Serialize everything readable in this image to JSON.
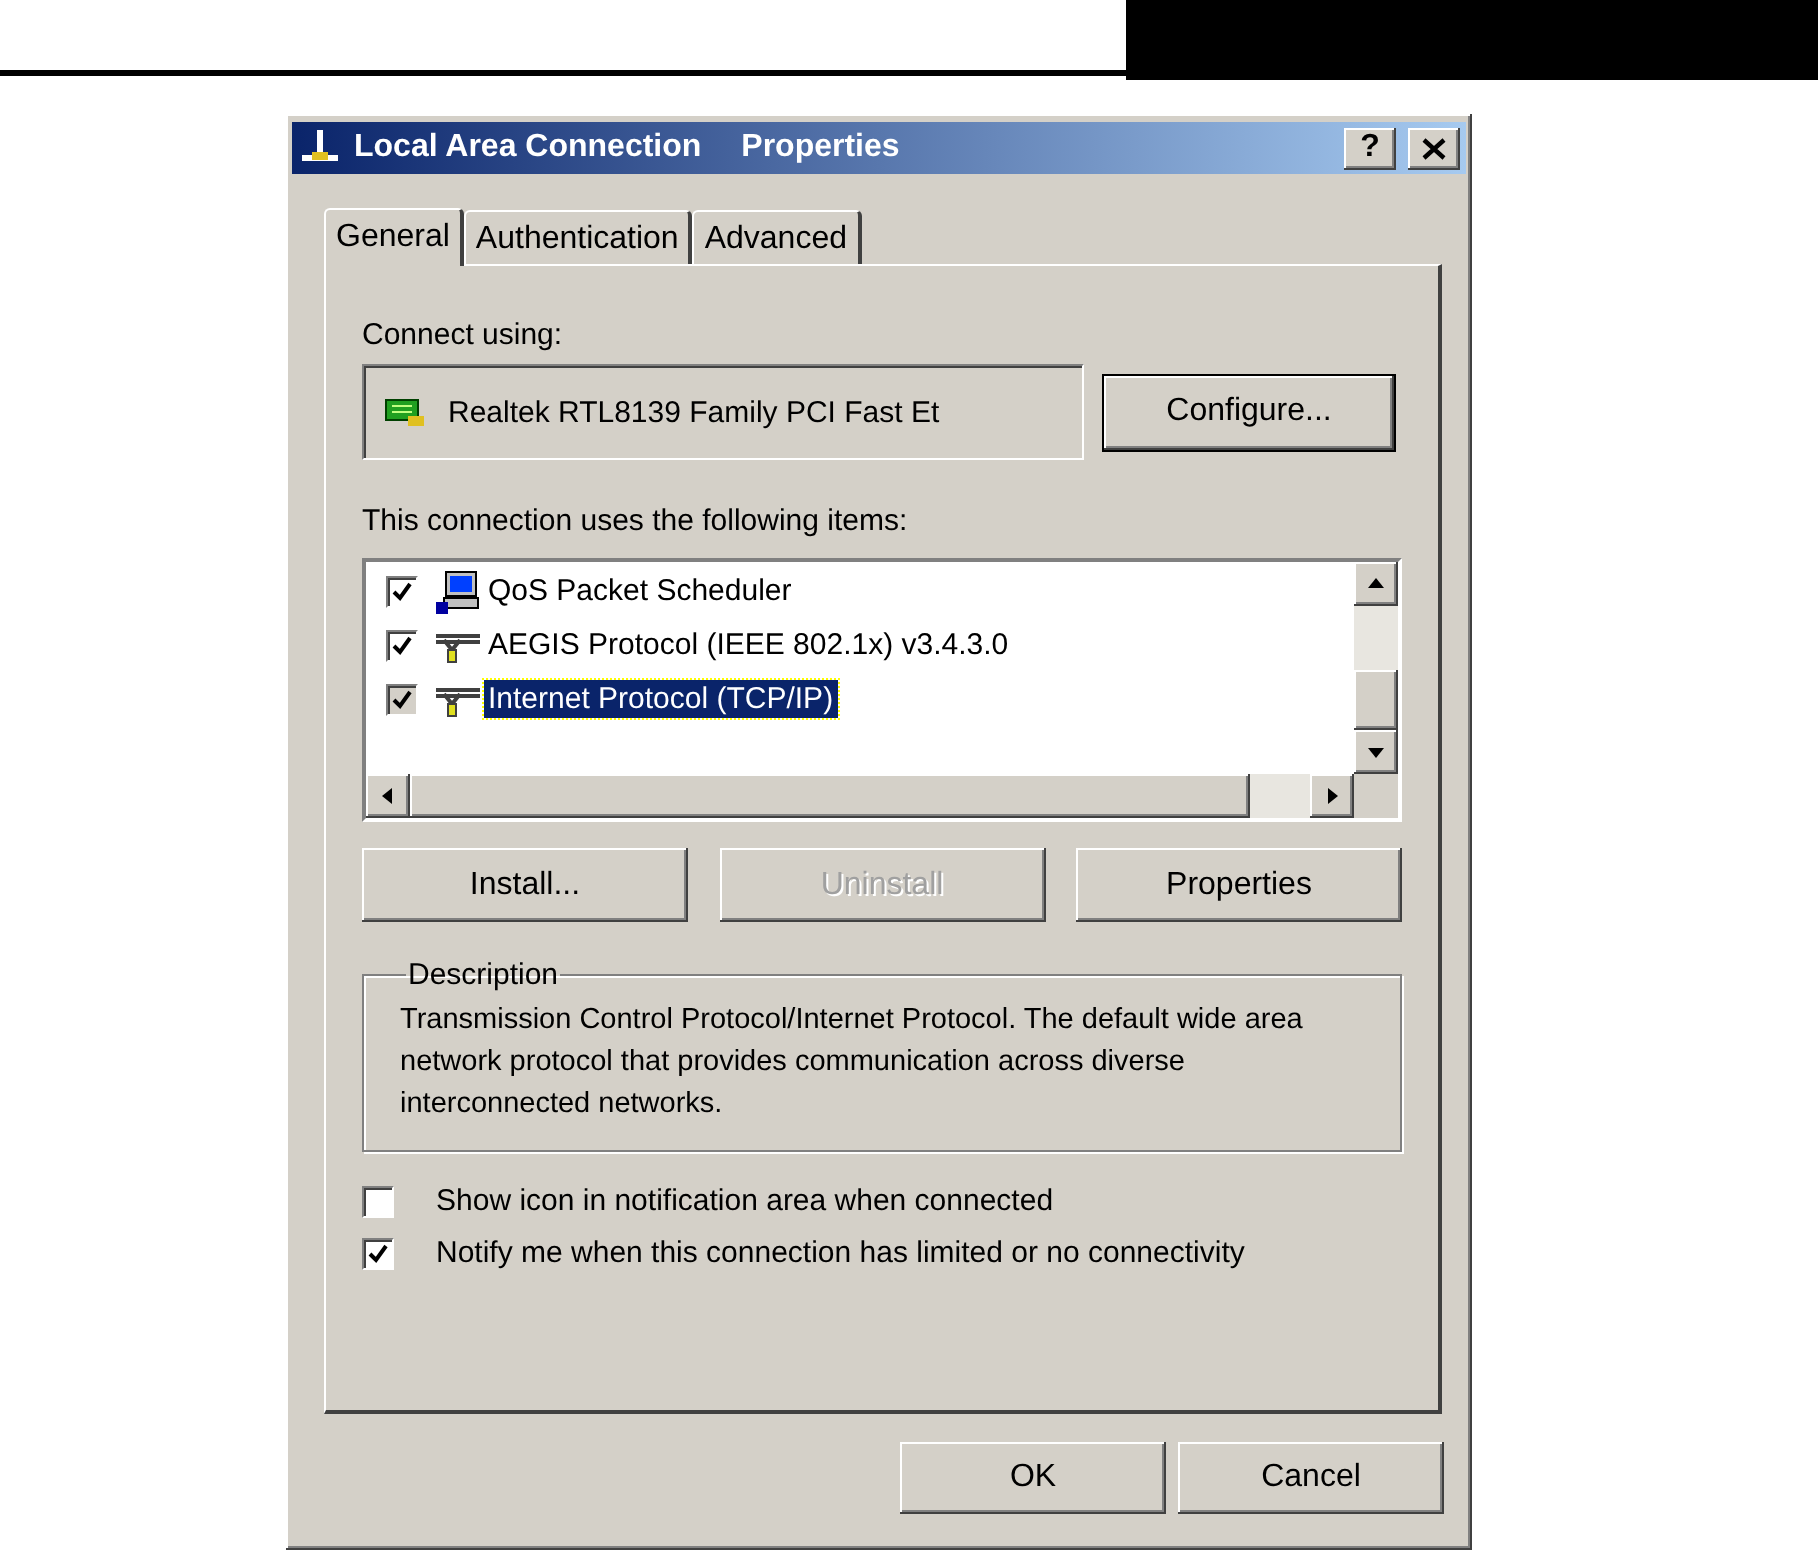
{
  "window": {
    "title_parts": [
      "Local Area Connection",
      "Properties"
    ],
    "help_button": "?"
  },
  "tabs": [
    {
      "label": "General",
      "selected": true
    },
    {
      "label": "Authentication",
      "selected": false
    },
    {
      "label": "Advanced",
      "selected": false
    }
  ],
  "connect_using": {
    "label": "Connect using:",
    "adapter": "Realtek RTL8139 Family PCI Fast Et",
    "button": "Configure..."
  },
  "components": {
    "label": "This connection uses the following items:",
    "items": [
      {
        "label": "QoS Packet Scheduler",
        "kind": "service",
        "checked": true,
        "selected": false
      },
      {
        "label": "AEGIS Protocol (IEEE 802.1x) v3.4.3.0",
        "kind": "protocol",
        "checked": true,
        "selected": false
      },
      {
        "label": "Internet Protocol (TCP/IP)",
        "kind": "protocol",
        "checked": true,
        "selected": true
      }
    ],
    "buttons": [
      {
        "label": "Install...",
        "disabled": false
      },
      {
        "label": "Uninstall",
        "disabled": true
      },
      {
        "label": "Properties",
        "disabled": false
      }
    ]
  },
  "description": {
    "title": "Description",
    "text": "Transmission Control Protocol/Internet Protocol. The default wide area network protocol that provides communication across diverse interconnected networks."
  },
  "options": [
    {
      "label": "Show icon in notification area when connected",
      "checked": false
    },
    {
      "label": "Notify me when this connection has limited or no connectivity",
      "checked": true
    }
  ],
  "dialog_buttons": [
    {
      "label": "OK"
    },
    {
      "label": "Cancel"
    }
  ]
}
